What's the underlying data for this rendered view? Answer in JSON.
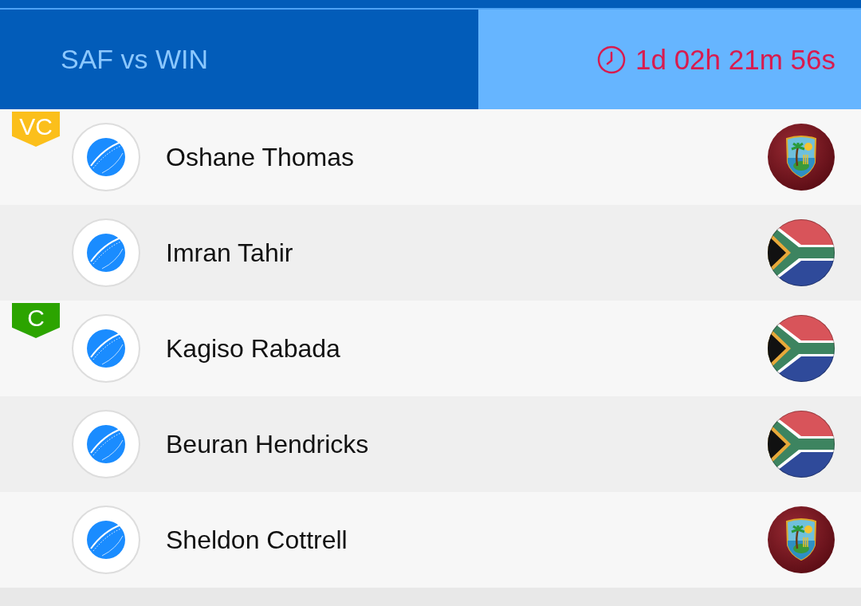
{
  "match": {
    "title": "SAF vs WIN",
    "countdown": "1d 02h 21m 56s"
  },
  "players": [
    {
      "name": "Oshane Thomas",
      "kind": "crest",
      "badge": {
        "label": "VC",
        "color": "#fbbf1b"
      }
    },
    {
      "name": "Imran Tahir",
      "kind": "flag"
    },
    {
      "name": "Kagiso Rabada",
      "kind": "flag",
      "badge": {
        "label": "C",
        "color": "#2ca400"
      }
    },
    {
      "name": "Beuran Hendricks",
      "kind": "flag"
    },
    {
      "name": "Sheldon Cottrell",
      "kind": "crest"
    }
  ]
}
